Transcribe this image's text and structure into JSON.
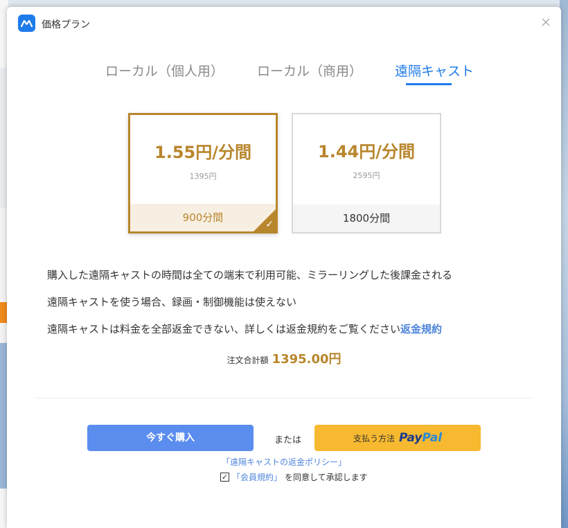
{
  "window": {
    "title": "価格プラン"
  },
  "tabs": [
    {
      "label": "ローカル（個人用）",
      "active": false
    },
    {
      "label": "ローカル（商用）",
      "active": false
    },
    {
      "label": "遠隔キャスト",
      "active": true
    }
  ],
  "plans": [
    {
      "price": "1.55円/分間",
      "original": "1395円",
      "duration": "900分間",
      "selected": true
    },
    {
      "price": "1.44円/分間",
      "original": "2595円",
      "duration": "1800分間",
      "selected": false
    }
  ],
  "info": {
    "line1": "購入した遠隔キャストの時間は全ての端末で利用可能、ミラーリングした後課金される",
    "line2": "遠隔キャストを使う場合、録画・制御機能は使えない",
    "line3": "遠隔キャストは料金を全部返金できない、詳しくは返金規約をご覧ください",
    "line3_link": "返金規約"
  },
  "order": {
    "label": "注文合計額",
    "amount": "1395.00円"
  },
  "actions": {
    "buy_label": "今すぐ購入",
    "or_label": "または",
    "paypal_label": "支払う方法",
    "paypal_logo_1": "Pay",
    "paypal_logo_2": "Pal"
  },
  "footer": {
    "refund_policy": "「遠隔キャストの返金ポリシー」",
    "terms_link": "「会員規約」",
    "agree_text": "を同意して承認します",
    "agreed": true
  },
  "colors": {
    "accent_blue": "#1e7bea",
    "gold": "#b8862c",
    "buy_button": "#5b8def",
    "paypal_button": "#f7b92f"
  }
}
